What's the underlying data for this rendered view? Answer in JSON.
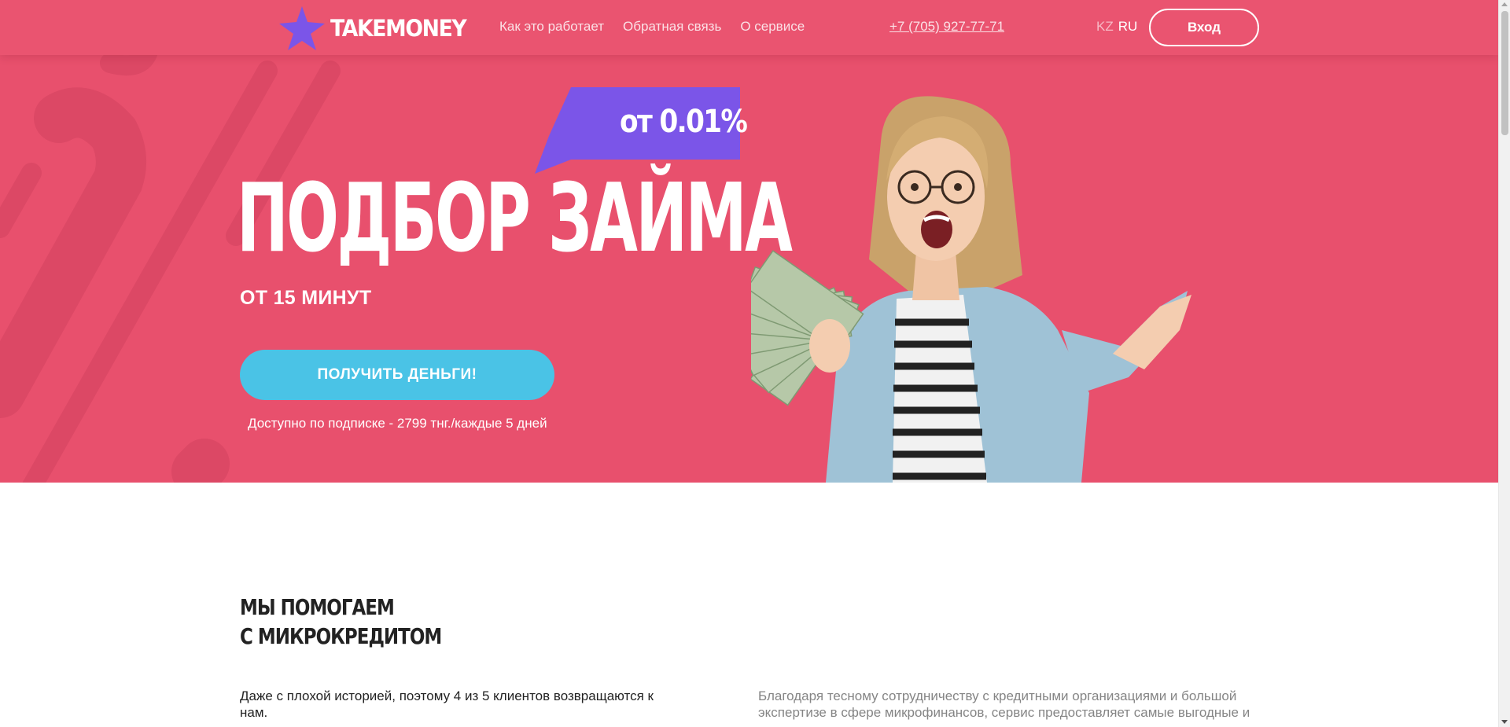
{
  "colors": {
    "hero_bg": "#e8506d",
    "header_bg": "#ea5470",
    "badge_bg": "#7b55e8",
    "cta_bg": "#4ac3e6",
    "text_dark": "#222222",
    "text_muted": "#858585"
  },
  "header": {
    "logo_icon": "star-logo-icon",
    "logo_text": "TAKEMONEY",
    "nav": [
      {
        "label": "Как это работает"
      },
      {
        "label": "Обратная связь"
      },
      {
        "label": "О сервисе"
      }
    ],
    "phone": "+7 (705) 927-77-71",
    "lang": {
      "kz": "KZ",
      "ru": "RU",
      "active": "RU"
    },
    "login_label": "Вход"
  },
  "hero": {
    "badge": "от 0.01%",
    "title": "ПОДБОР ЗАЙМА",
    "subtitle": "ОТ 15 МИНУТ",
    "cta_label": "ПОЛУЧИТЬ ДЕНЬГИ!",
    "note": "Доступно по подписке - 2799 тнг./каждые 5 дней",
    "photo": "woman-holding-money-photo"
  },
  "section": {
    "title_line1": "МЫ ПОМОГАЕМ",
    "title_line2": "С МИКРОКРЕДИТОМ",
    "left_text": "Даже с плохой историей, поэтому 4 из 5 клиентов возвращаются к нам.",
    "right_text": "Благодаря тесному сотрудничеству с кредитными организациями и большой экспертизе в сфере микрофинансов, сервис предоставляет самые выгодные и"
  }
}
